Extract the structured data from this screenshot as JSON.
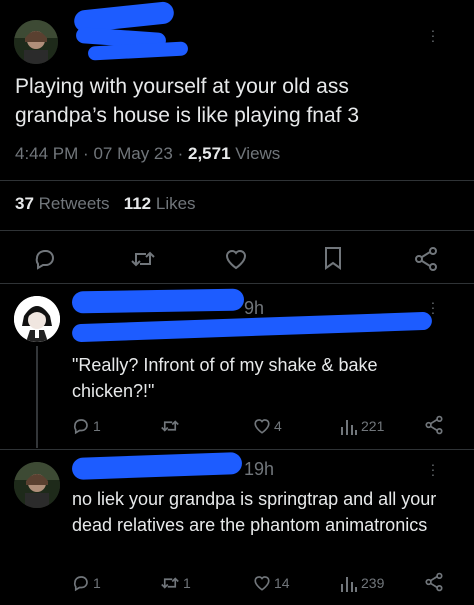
{
  "main_tweet": {
    "text_line1": "Playing with yourself at your old ass",
    "text_line2": "grandpa’s house is like playing fnaf 3",
    "time": "4:44 PM",
    "date": "07 May 23",
    "views_count": "2,571",
    "views_label": "Views",
    "retweets_count": "37",
    "retweets_label": "Retweets",
    "likes_count": "112",
    "likes_label": "Likes"
  },
  "replies": [
    {
      "time": "9h",
      "text": "\"Really? Infront of of my shake & bake chicken?!\"",
      "reply_count": "1",
      "retweet_count": "",
      "like_count": "4",
      "view_count": "221"
    },
    {
      "time": "19h",
      "text": "no liek your grandpa is springtrap and all your dead relatives are the phantom animatronics",
      "reply_count": "1",
      "retweet_count": "1",
      "like_count": "14",
      "view_count": "239"
    }
  ],
  "separator": "·",
  "colors": {
    "background": "#000000",
    "text": "#e7e9ea",
    "muted": "#71767b",
    "redaction": "#1d5cff",
    "divider": "#2f3336"
  },
  "icons": [
    "reply-icon",
    "retweet-icon",
    "like-icon",
    "bookmark-icon",
    "share-icon",
    "views-icon",
    "more-icon"
  ]
}
